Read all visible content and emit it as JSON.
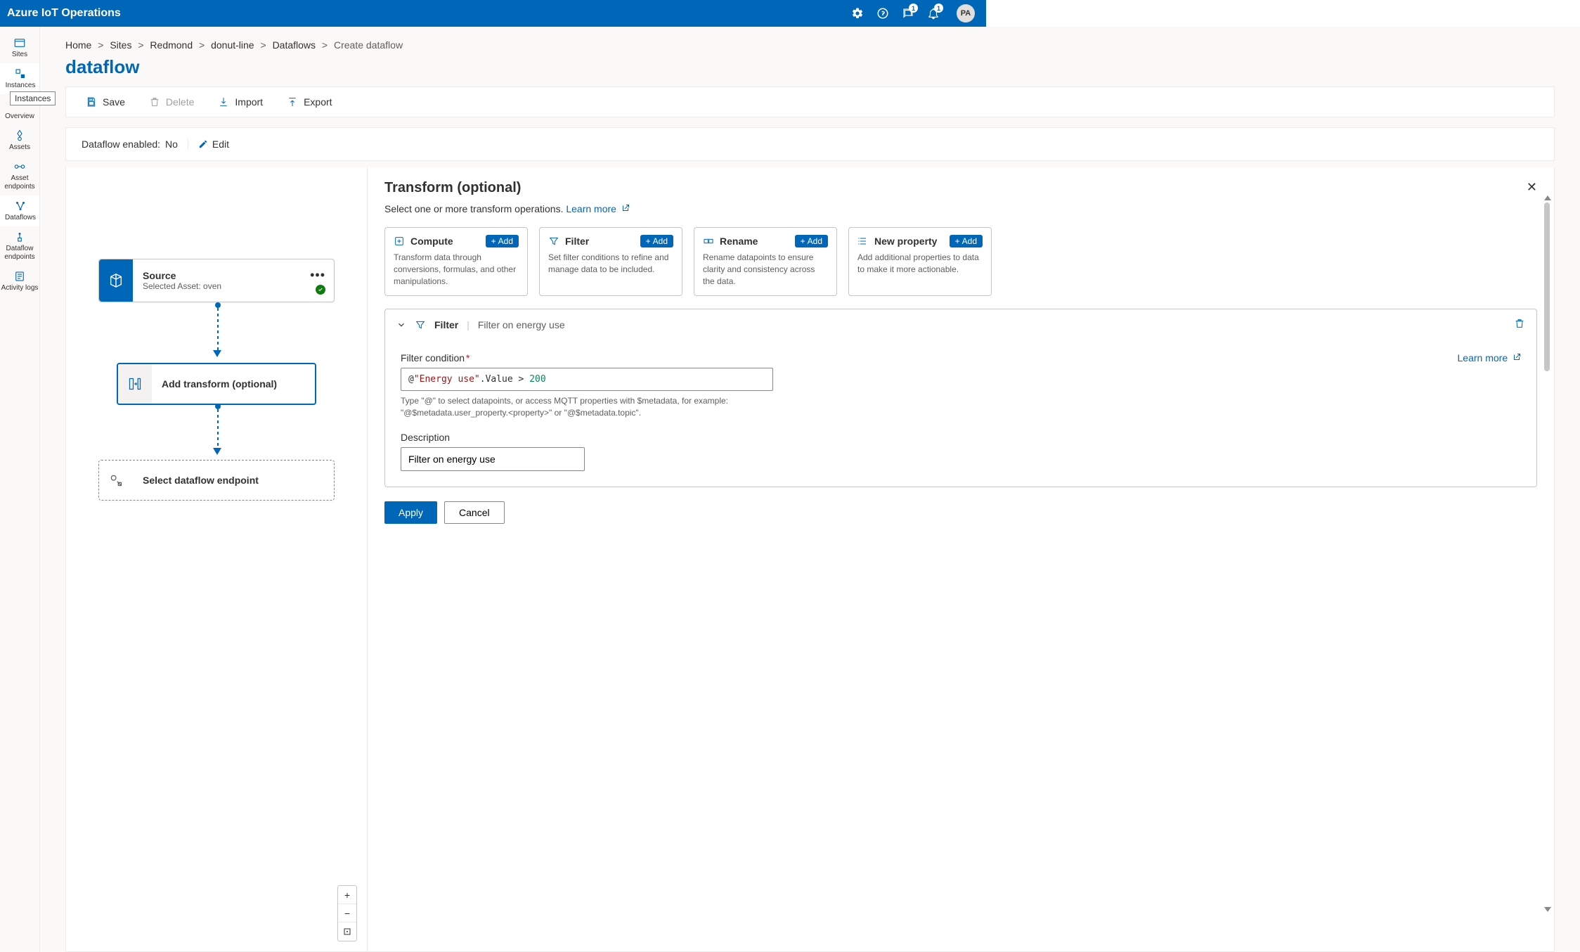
{
  "header": {
    "app_title": "Azure IoT Operations",
    "avatar_initials": "PA",
    "badge_feedback": "1",
    "badge_bell": "1"
  },
  "sidebar": {
    "items": [
      {
        "label": "Sites",
        "icon": "sites"
      },
      {
        "label": "Instances",
        "icon": "instances"
      },
      {
        "label": "Overview",
        "icon": "overview"
      },
      {
        "label": "Assets",
        "icon": "assets"
      },
      {
        "label": "Asset endpoints",
        "icon": "asset-endpoints"
      },
      {
        "label": "Dataflows",
        "icon": "dataflows"
      },
      {
        "label": "Dataflow endpoints",
        "icon": "dataflow-endpoints"
      },
      {
        "label": "Activity logs",
        "icon": "activity-logs"
      }
    ],
    "tooltip": "Instances"
  },
  "breadcrumb": {
    "items": [
      "Home",
      "Sites",
      "Redmond",
      "donut-line",
      "Dataflows",
      "Create dataflow"
    ]
  },
  "page": {
    "title": "dataflow"
  },
  "toolbar": {
    "save": "Save",
    "delete": "Delete",
    "import": "Import",
    "export": "Export"
  },
  "status": {
    "label": "Dataflow enabled:",
    "value": "No",
    "edit": "Edit"
  },
  "canvas": {
    "source": {
      "title": "Source",
      "subtitle": "Selected Asset: oven"
    },
    "transform": {
      "title": "Add transform (optional)"
    },
    "endpoint": {
      "title": "Select dataflow endpoint"
    }
  },
  "panel": {
    "title": "Transform (optional)",
    "subtitle_prefix": "Select one or more transform operations. ",
    "learn_more": "Learn more",
    "ops": [
      {
        "key": "compute",
        "title": "Compute",
        "desc": "Transform data through conversions, formulas, and other manipulations."
      },
      {
        "key": "filter",
        "title": "Filter",
        "desc": "Set filter conditions to refine and manage data to be included."
      },
      {
        "key": "rename",
        "title": "Rename",
        "desc": "Rename datapoints to ensure clarity and consistency across the data."
      },
      {
        "key": "newprop",
        "title": "New property",
        "desc": "Add additional properties to data to make it more actionable."
      }
    ],
    "add_label": "Add",
    "filter_block": {
      "head_title": "Filter",
      "head_sub": "Filter on energy use",
      "condition_label": "Filter condition",
      "condition_code": {
        "at": "@",
        "field": "\"Energy use\"",
        "prop": ".Value",
        "op": " > ",
        "num": "200"
      },
      "hint": "Type \"@\" to select datapoints, or access MQTT properties with $metadata, for example: \"@$metadata.user_property.<property>\" or \"@$metadata.topic\".",
      "learn_more": "Learn more",
      "description_label": "Description",
      "description_value": "Filter on energy use"
    },
    "apply": "Apply",
    "cancel": "Cancel"
  }
}
